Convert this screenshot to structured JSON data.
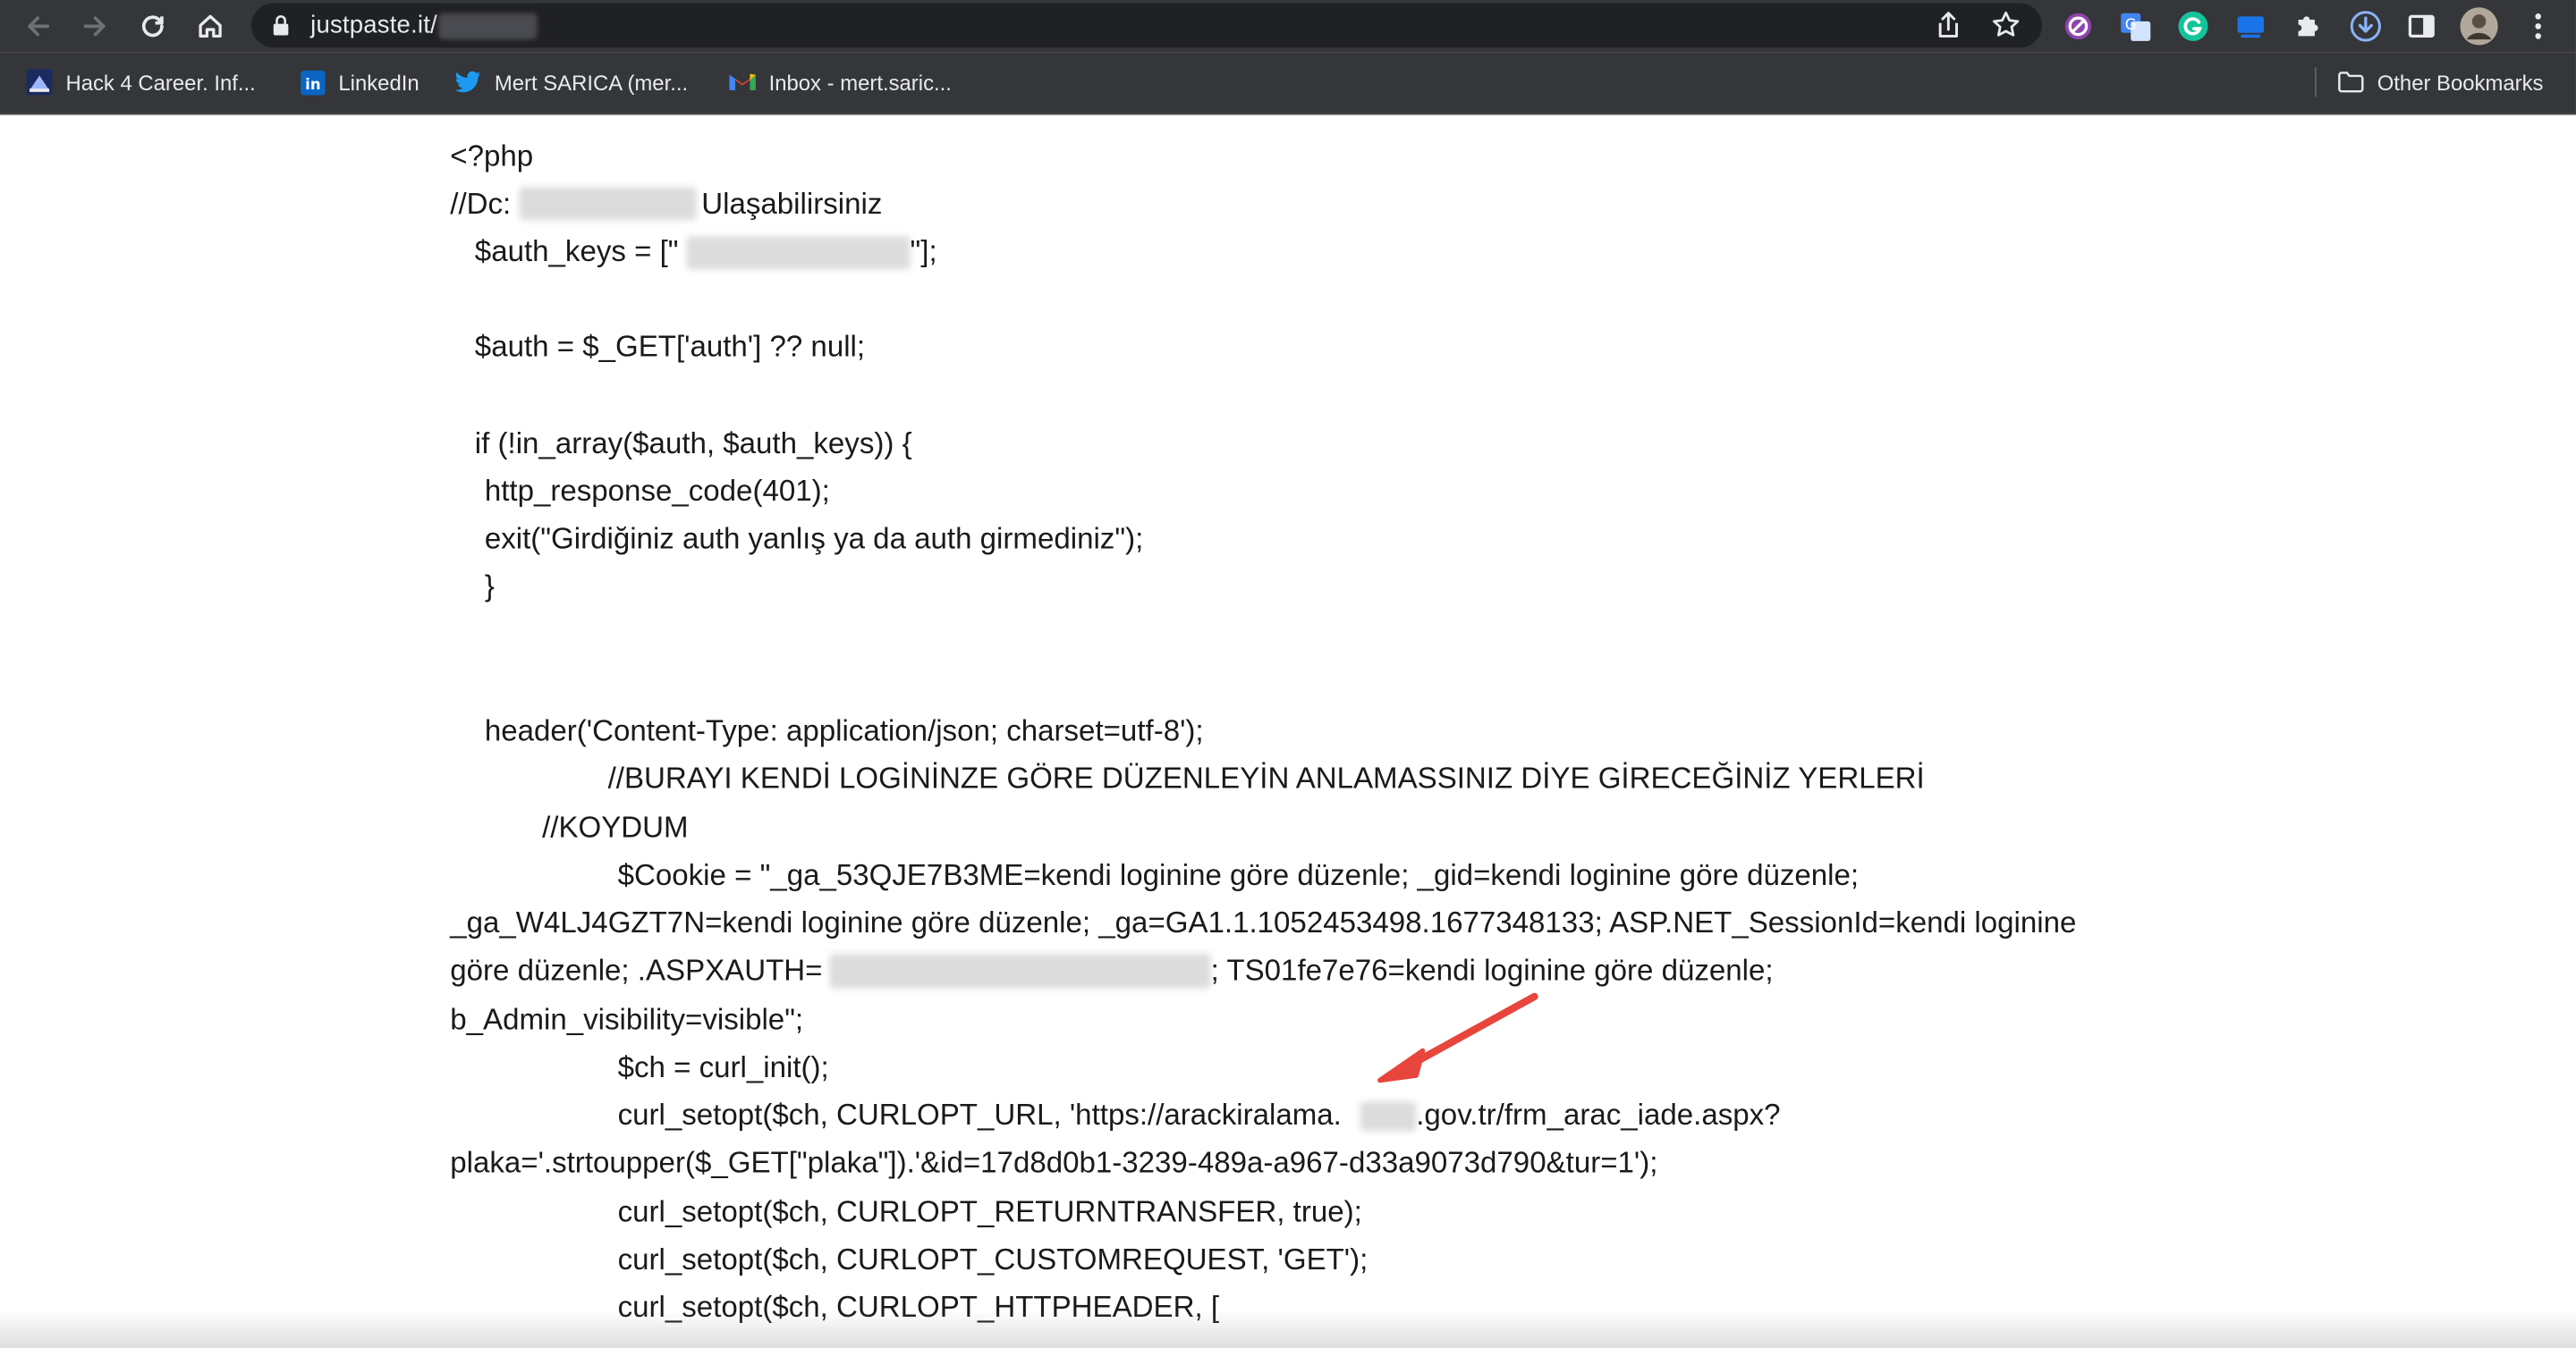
{
  "browser": {
    "url": "justpaste.it/",
    "bookmarks": [
      {
        "label": "Hack 4 Career. Inf...",
        "icon": "hack4career-icon"
      },
      {
        "label": "LinkedIn",
        "icon": "linkedin-icon"
      },
      {
        "label": "Mert SARICA (mer...",
        "icon": "twitter-icon"
      },
      {
        "label": "Inbox - mert.saric...",
        "icon": "gmail-icon"
      }
    ],
    "other_bookmarks": "Other Bookmarks"
  },
  "code": {
    "l1": "<?php",
    "l2a": "//Dc:",
    "l2b": "Ulaşabilirsiniz",
    "l3a": "$auth_keys = [\"",
    "l3b": "\"];",
    "l4": "$auth = $_GET['auth'] ?? null;",
    "l5": "if (!in_array($auth, $auth_keys)) {",
    "l6": "http_response_code(401);",
    "l7": "exit(\"Girdiğiniz auth yanlış ya da auth girmediniz\");",
    "l8": "}",
    "l9": "header('Content-Type: application/json; charset=utf-8');",
    "l10": "//BURAYI KENDİ LOGİNİNZE GÖRE DÜZENLEYİN ANLAMASSINIZ DİYE GİRECEĞİNİZ YERLERİ",
    "l11": "//KOYDUM",
    "l12": "$Cookie = \"_ga_53QJE7B3ME=kendi loginine göre düzenle; _gid=kendi loginine göre düzenle;",
    "l13": "_ga_W4LJ4GZT7N=kendi loginine göre düzenle; _ga=GA1.1.1052453498.1677348133; ASP.NET_SessionId=kendi loginine",
    "l14a": "göre düzenle; .ASPXAUTH=",
    "l14b": "; TS01fe7e76=kendi loginine göre düzenle;",
    "l15": "b_Admin_visibility=visible\";",
    "l16": "$ch = curl_init();",
    "l17a": "curl_setopt($ch, CURLOPT_URL, 'https://arackiralama.",
    "l17b": ".gov.tr/frm_arac_iade.aspx?",
    "l18": "plaka='.strtoupper($_GET[\"plaka\"]).'&id=17d8d0b1-3239-489a-a967-d33a9073d790&tur=1');",
    "l19": "curl_setopt($ch, CURLOPT_RETURNTRANSFER, true);",
    "l20": "curl_setopt($ch, CURLOPT_CUSTOMREQUEST, 'GET');",
    "l21": "curl_setopt($ch, CURLOPT_HTTPHEADER, ["
  },
  "colors": {
    "chrome_bg": "#35363a",
    "omnibox_bg": "#202124",
    "arrow": "#e8453c"
  }
}
